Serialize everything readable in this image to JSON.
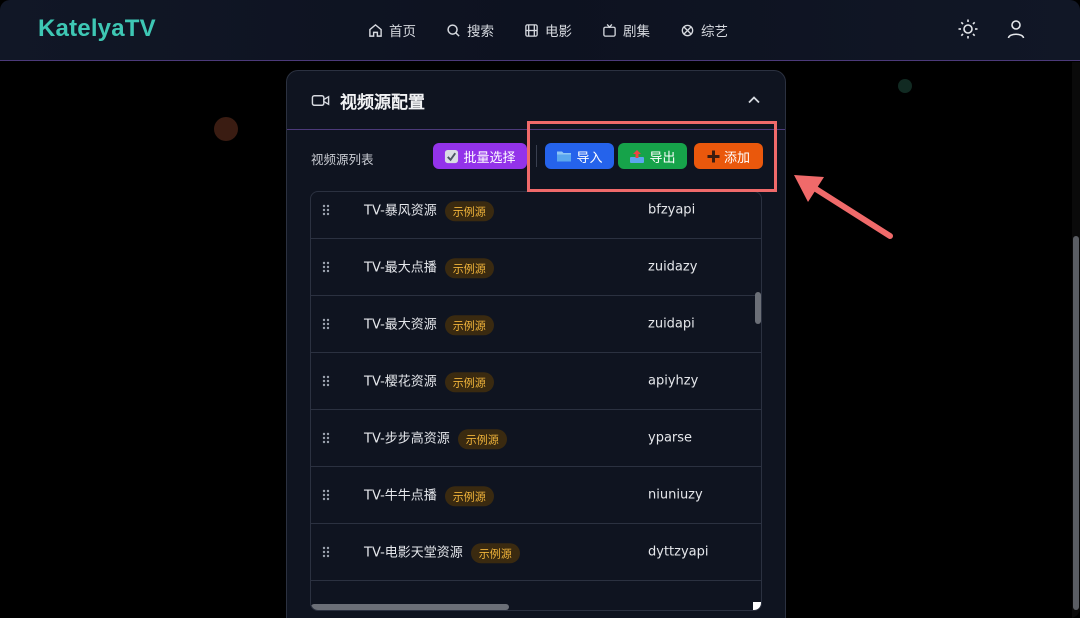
{
  "app": {
    "name": "KatelyaTV"
  },
  "nav": [
    {
      "label": "首页",
      "icon": "home-icon"
    },
    {
      "label": "搜索",
      "icon": "search-icon"
    },
    {
      "label": "电影",
      "icon": "film-icon"
    },
    {
      "label": "剧集",
      "icon": "tv-icon"
    },
    {
      "label": "综艺",
      "icon": "sparkle-icon"
    }
  ],
  "top_icons": {
    "theme": "sun-icon",
    "user": "user-icon"
  },
  "panel": {
    "title": "视频源配置",
    "list_label": "视频源列表",
    "buttons": {
      "batch": "批量选择",
      "import": "导入",
      "export": "导出",
      "add": "添加"
    },
    "rows": [
      {
        "name": "TV-暴风资源",
        "badge": "示例源",
        "key": "bfzyapi"
      },
      {
        "name": "TV-最大点播",
        "badge": "示例源",
        "key": "zuidazy"
      },
      {
        "name": "TV-最大资源",
        "badge": "示例源",
        "key": "zuidapi"
      },
      {
        "name": "TV-樱花资源",
        "badge": "示例源",
        "key": "apiyhzy"
      },
      {
        "name": "TV-步步高资源",
        "badge": "示例源",
        "key": "yparse"
      },
      {
        "name": "TV-牛牛点播",
        "badge": "示例源",
        "key": "niuniuzy"
      },
      {
        "name": "TV-电影天堂资源",
        "badge": "示例源",
        "key": "dyttzyapi"
      }
    ]
  },
  "colors": {
    "accent_logo": "#3ec7b4",
    "batch": "#9333ea",
    "import": "#2563eb",
    "export": "#16a34a",
    "add": "#ea580c",
    "badge_text": "#f1b43a",
    "highlight": "#f06a6a"
  }
}
